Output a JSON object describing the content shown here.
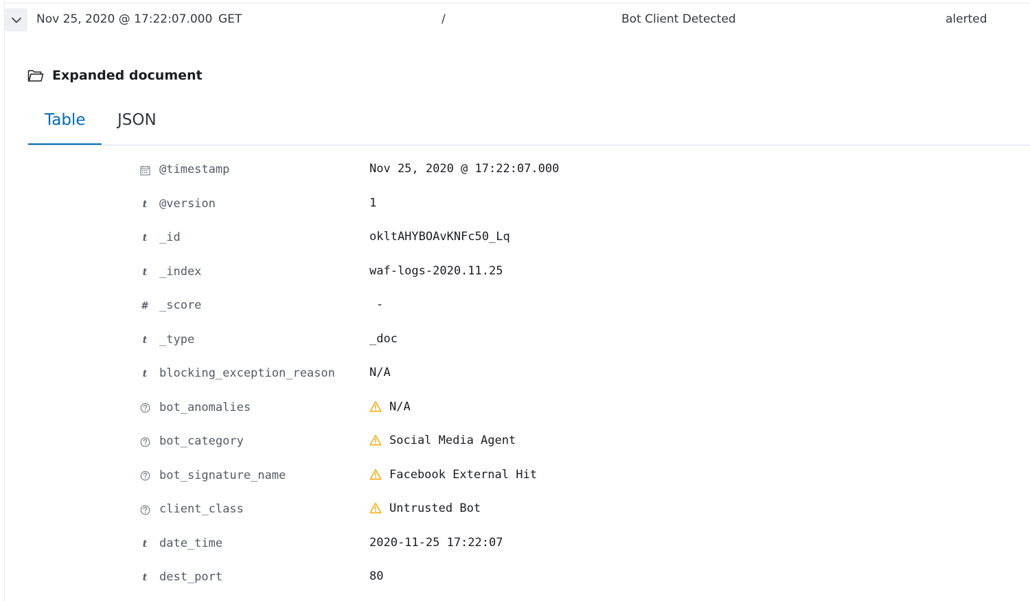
{
  "summary": {
    "timestamp": "Nov 25, 2020 @ 17:22:07.000",
    "method": "GET",
    "path": "/",
    "violation": "Bot Client Detected",
    "status": "alerted"
  },
  "header": {
    "title": "Expanded document",
    "icon": "folder-open-icon"
  },
  "tabs": [
    {
      "label": "Table",
      "selected": true
    },
    {
      "label": "JSON",
      "selected": false
    }
  ],
  "colors": {
    "accent": "#006bb8",
    "warning": "#f5a700",
    "text": "#343741"
  },
  "fields": [
    {
      "type": "date",
      "icon": "calendar-icon",
      "name": "@timestamp",
      "value": "Nov 25, 2020 @ 17:22:07.000",
      "warning": false
    },
    {
      "type": "string",
      "icon": "t",
      "name": "@version",
      "value": "1",
      "warning": false
    },
    {
      "type": "string",
      "icon": "t",
      "name": "_id",
      "value": "okltAHYBOAvKNFc50_Lq",
      "warning": false
    },
    {
      "type": "string",
      "icon": "t",
      "name": "_index",
      "value": "waf-logs-2020.11.25",
      "warning": false
    },
    {
      "type": "number",
      "icon": "#",
      "name": "_score",
      "value": "-",
      "warning": false
    },
    {
      "type": "string",
      "icon": "t",
      "name": "_type",
      "value": "_doc",
      "warning": false
    },
    {
      "type": "string",
      "icon": "t",
      "name": "blocking_exception_reason",
      "value": "N/A",
      "warning": false
    },
    {
      "type": "unknown",
      "icon": "question-icon",
      "name": "bot_anomalies",
      "value": "N/A",
      "warning": true
    },
    {
      "type": "unknown",
      "icon": "question-icon",
      "name": "bot_category",
      "value": "Social Media Agent",
      "warning": true
    },
    {
      "type": "unknown",
      "icon": "question-icon",
      "name": "bot_signature_name",
      "value": "Facebook External Hit",
      "warning": true
    },
    {
      "type": "unknown",
      "icon": "question-icon",
      "name": "client_class",
      "value": "Untrusted Bot",
      "warning": true
    },
    {
      "type": "string",
      "icon": "t",
      "name": "date_time",
      "value": "2020-11-25 17:22:07",
      "warning": false
    },
    {
      "type": "string",
      "icon": "t",
      "name": "dest_port",
      "value": "80",
      "warning": false
    }
  ]
}
